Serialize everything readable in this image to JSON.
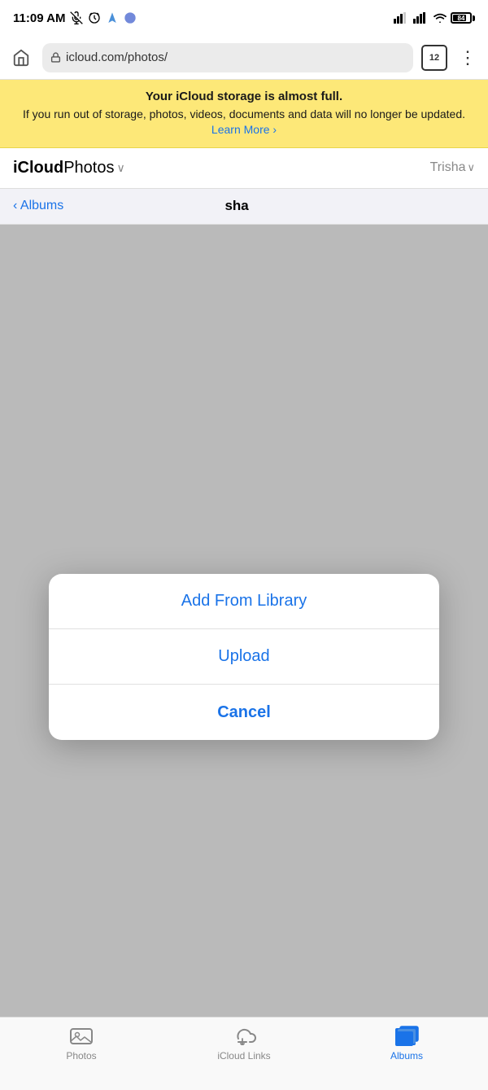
{
  "statusBar": {
    "time": "11:09 AM",
    "battery": "84"
  },
  "browserBar": {
    "url": "icloud.com/photos/",
    "tabCount": "12"
  },
  "storageBanner": {
    "title": "Your iCloud storage is almost full.",
    "body": "If you run out of storage, photos, videos, documents and data will no longer be updated.",
    "linkText": "Learn More ›"
  },
  "icloudHeader": {
    "appName": "iCloud",
    "section": " Photos",
    "dropdownIcon": "∨",
    "userName": "Trisha",
    "userDropdown": "∨"
  },
  "albumsNav": {
    "backLabel": "‹ Albums",
    "currentAlbum": "sha"
  },
  "actionSheet": {
    "items": [
      {
        "label": "Add From Library"
      },
      {
        "label": "Upload"
      },
      {
        "label": "Cancel"
      }
    ]
  },
  "tabBar": {
    "tabs": [
      {
        "id": "photos",
        "label": "Photos",
        "active": false
      },
      {
        "id": "icloud-links",
        "label": "iCloud Links",
        "active": false
      },
      {
        "id": "albums",
        "label": "Albums",
        "active": true
      }
    ]
  }
}
